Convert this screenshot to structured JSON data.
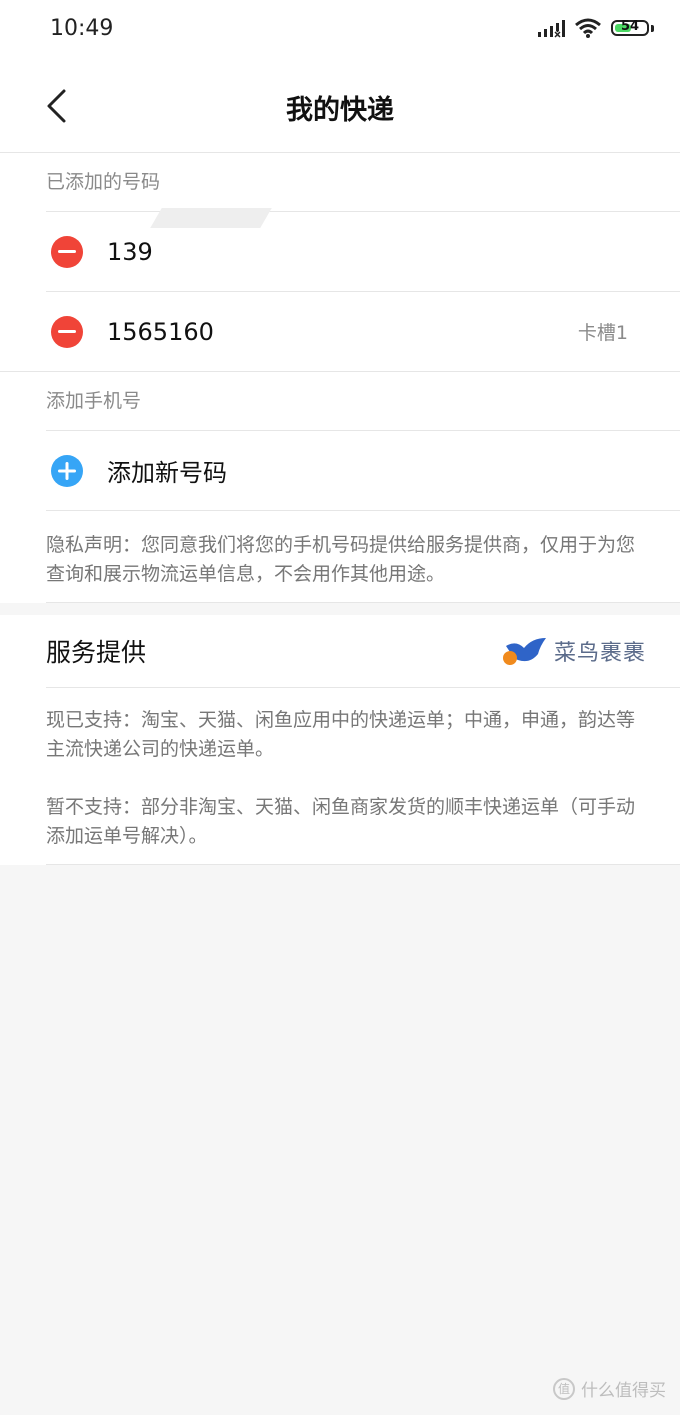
{
  "status_bar": {
    "time": "10:49",
    "battery_level": "54",
    "battery_fraction": 0.54
  },
  "header": {
    "title": "我的快递",
    "back_icon": "chevron-left-icon"
  },
  "added_numbers": {
    "label": "已添加的号码",
    "items": [
      {
        "number": "139",
        "slot": ""
      },
      {
        "number": "1565160",
        "slot": "卡槽1"
      }
    ]
  },
  "add_phone": {
    "label": "添加手机号",
    "button_label": "添加新号码"
  },
  "privacy": {
    "text": "隐私声明：您同意我们将您的手机号码提供给服务提供商，仅用于为您查询和展示物流运单信息，不会用作其他用途。"
  },
  "service": {
    "title": "服务提供",
    "brand_name": "菜鸟裹裹",
    "supported": "现已支持：淘宝、天猫、闲鱼应用中的快递运单；中通，申通，韵达等主流快递公司的快递运单。",
    "unsupported": "暂不支持：部分非淘宝、天猫、闲鱼商家发货的顺丰快递运单（可手动添加运单号解决）。"
  },
  "watermark": {
    "text": "什么值得买",
    "icon_text": "值"
  },
  "colors": {
    "remove_red": "#f04438",
    "add_blue": "#36a5f6",
    "battery_green": "#4cd964"
  }
}
